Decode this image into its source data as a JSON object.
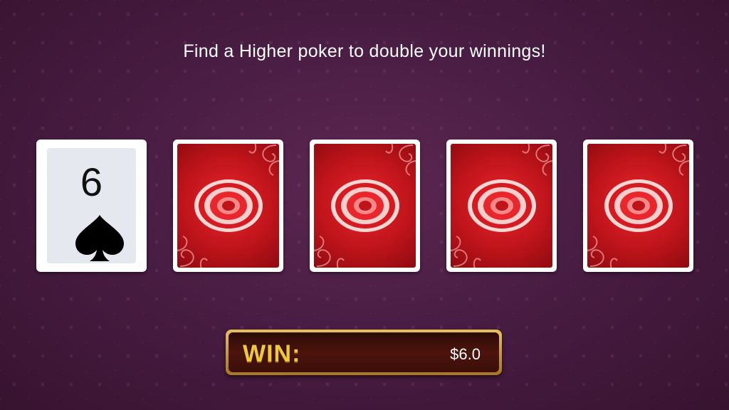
{
  "header": {
    "prompt": "Find a Higher poker to double your winnings!"
  },
  "cards": [
    {
      "state": "face-up",
      "rank": "6",
      "suit": "spade"
    },
    {
      "state": "face-down"
    },
    {
      "state": "face-down"
    },
    {
      "state": "face-down"
    },
    {
      "state": "face-down"
    }
  ],
  "win": {
    "label": "WIN:",
    "amount": "$6.0"
  },
  "colors": {
    "background": "#4a1d44",
    "card_back": "#c0141b",
    "win_label": "#f0c63a"
  }
}
